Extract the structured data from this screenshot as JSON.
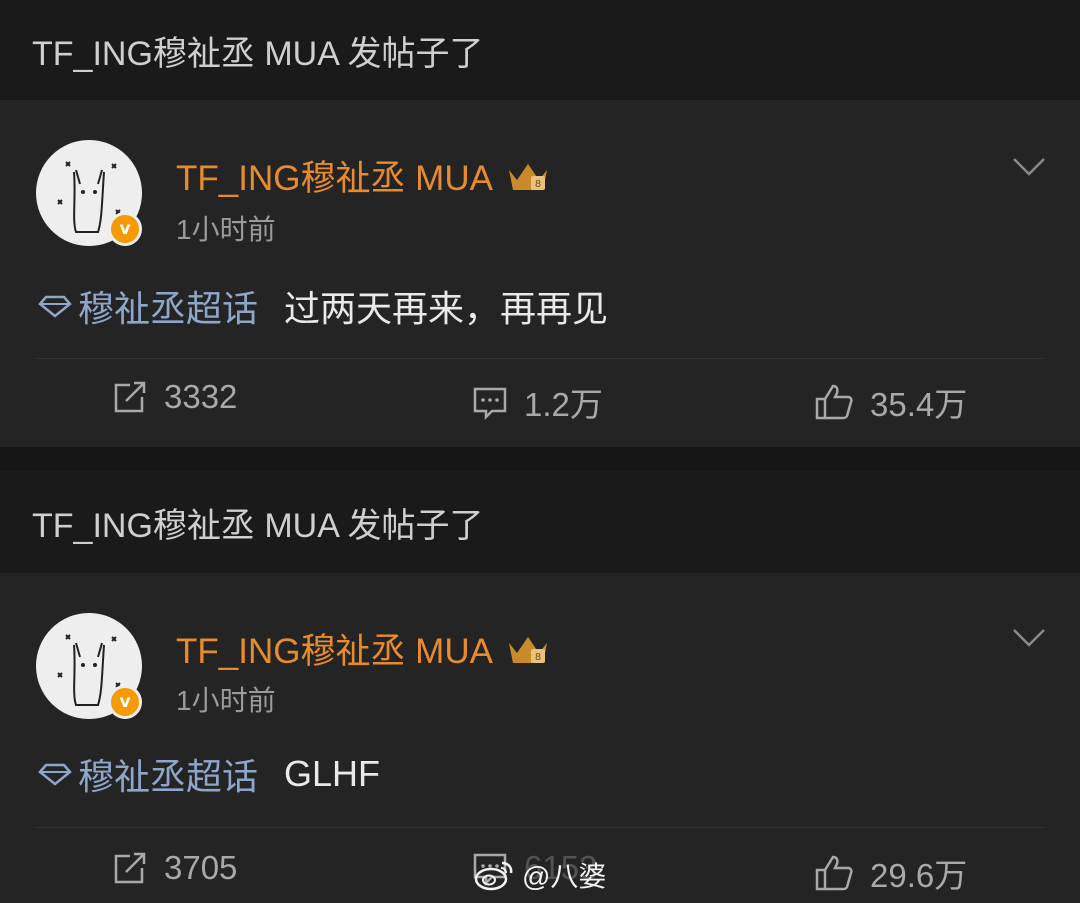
{
  "posts": [
    {
      "header_text": "TF_ING穆祉丞 MUA 发帖子了",
      "username": "TF_ING穆祉丞 MUA",
      "timestamp": "1小时前",
      "topic": "穆祉丞超话",
      "text": "过两天再来，再再见",
      "reposts": "3332",
      "comments": "1.2万",
      "likes": "35.4万"
    },
    {
      "header_text": "TF_ING穆祉丞 MUA 发帖子了",
      "username": "TF_ING穆祉丞 MUA",
      "timestamp": "1小时前",
      "topic": "穆祉丞超话",
      "text": "GLHF",
      "reposts": "3705",
      "comments": "6153",
      "likes": "29.6万"
    }
  ],
  "watermark": "@八婆",
  "icons": {
    "verified": "verified-v-icon",
    "crown": "crown-badge-icon",
    "menu": "chevron-down-icon",
    "topic": "diamond-icon",
    "repost": "repost-icon",
    "comment": "comment-icon",
    "like": "thumbs-up-icon",
    "watermark": "weibo-logo-icon"
  },
  "colors": {
    "username": "#e88a2e",
    "topic": "#8fa6c9",
    "verified_badge": "#f59a00"
  }
}
